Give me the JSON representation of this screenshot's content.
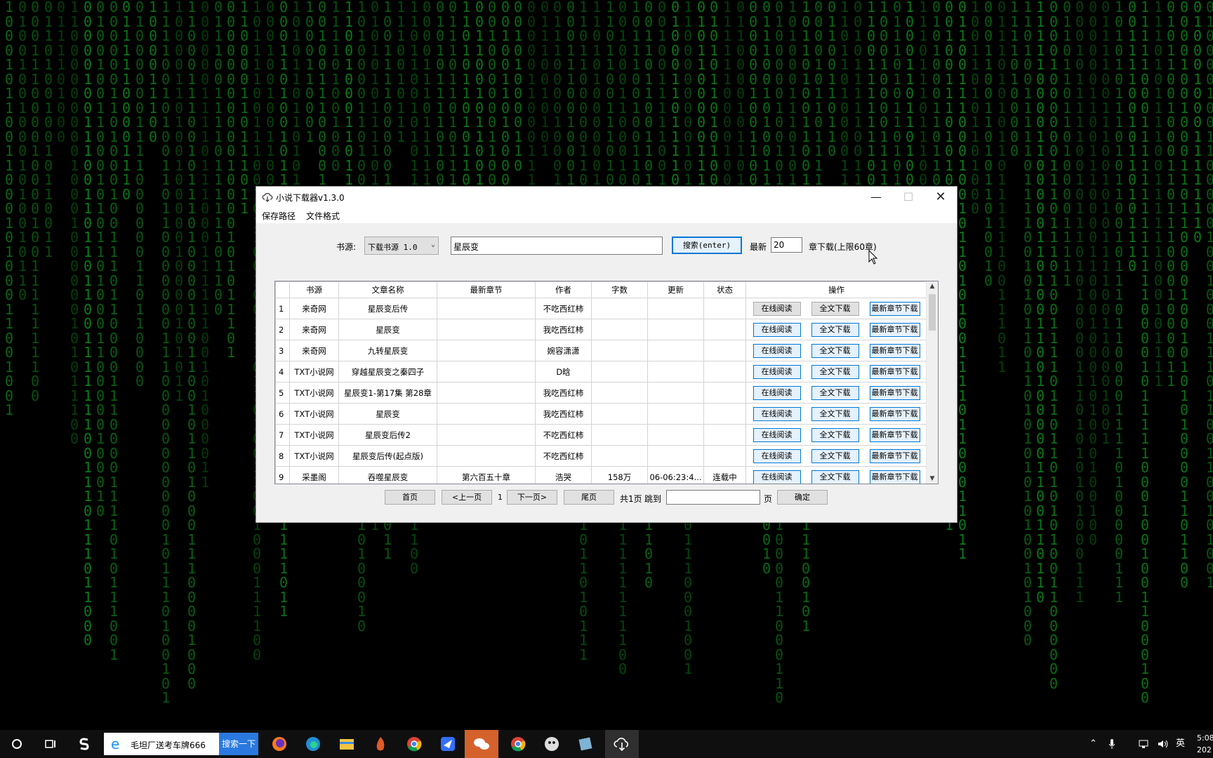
{
  "window": {
    "title": "小说下载器v1.3.0",
    "minimize_glyph": "—",
    "maximize_glyph": "☐",
    "close_glyph": "✕",
    "icon": "cloud-download-icon"
  },
  "menu": {
    "save_path": "保存路径",
    "file_format": "文件格式"
  },
  "search_bar": {
    "source_label": "书源:",
    "source_value": "下载书源 1.0",
    "query": "星辰变",
    "search_button": "搜索(enter)",
    "latest_label": "最新",
    "latest_value": "20",
    "latest_suffix": "章下载(上限60章)"
  },
  "table": {
    "headers": [
      "书源",
      "文章名称",
      "最新章节",
      "作者",
      "字数",
      "更新",
      "状态",
      "操作"
    ],
    "op_labels": {
      "read": "在线阅读",
      "full": "全文下载",
      "latest": "最新章节下载"
    },
    "rows": [
      {
        "no": "1",
        "source": "来奇网",
        "name": "星辰变后传",
        "latest": "",
        "author": "不吃西红柿",
        "words": "",
        "updated": "",
        "status": ""
      },
      {
        "no": "2",
        "source": "来奇网",
        "name": "星辰变",
        "latest": "",
        "author": "我吃西红柿",
        "words": "",
        "updated": "",
        "status": ""
      },
      {
        "no": "3",
        "source": "来奇网",
        "name": "九转星辰变",
        "latest": "",
        "author": "婉容潇潇",
        "words": "",
        "updated": "",
        "status": ""
      },
      {
        "no": "4",
        "source": "TXT小说网",
        "name": "穿越星辰变之秦四子",
        "latest": "",
        "author": "D晗",
        "words": "",
        "updated": "",
        "status": ""
      },
      {
        "no": "5",
        "source": "TXT小说网",
        "name": "星辰变1-第17集 第28章",
        "latest": "",
        "author": "我吃西红柿",
        "words": "",
        "updated": "",
        "status": ""
      },
      {
        "no": "6",
        "source": "TXT小说网",
        "name": "星辰变",
        "latest": "",
        "author": "我吃西红柿",
        "words": "",
        "updated": "",
        "status": ""
      },
      {
        "no": "7",
        "source": "TXT小说网",
        "name": "星辰变后传2",
        "latest": "",
        "author": "不吃西红柿",
        "words": "",
        "updated": "",
        "status": ""
      },
      {
        "no": "8",
        "source": "TXT小说网",
        "name": "星辰变后传(起点版)",
        "latest": "",
        "author": "不吃西红柿",
        "words": "",
        "updated": "",
        "status": ""
      },
      {
        "no": "9",
        "source": "采墨阁",
        "name": "吞噬星辰变",
        "latest": "第六百五十章",
        "author": "浩哭",
        "words": "158万",
        "updated": "06-06:23:4...",
        "status": "连载中"
      }
    ]
  },
  "pagination": {
    "first": "首页",
    "prev": "<上一页",
    "current": "1",
    "next": "下一页>",
    "last": "尾页",
    "total": "共1页",
    "jump_label": "跳到",
    "jump_value": "",
    "page_suffix": "页",
    "confirm": "确定"
  },
  "taskbar": {
    "search_text": "毛坦厂送考车牌666",
    "search_button": "搜索一下",
    "ime": "英",
    "time": "5:08",
    "date": "202"
  },
  "colors": {
    "matrix_green": "#0c7d1a",
    "accent": "#0078d7",
    "taskbar": "#0f0f0f"
  }
}
